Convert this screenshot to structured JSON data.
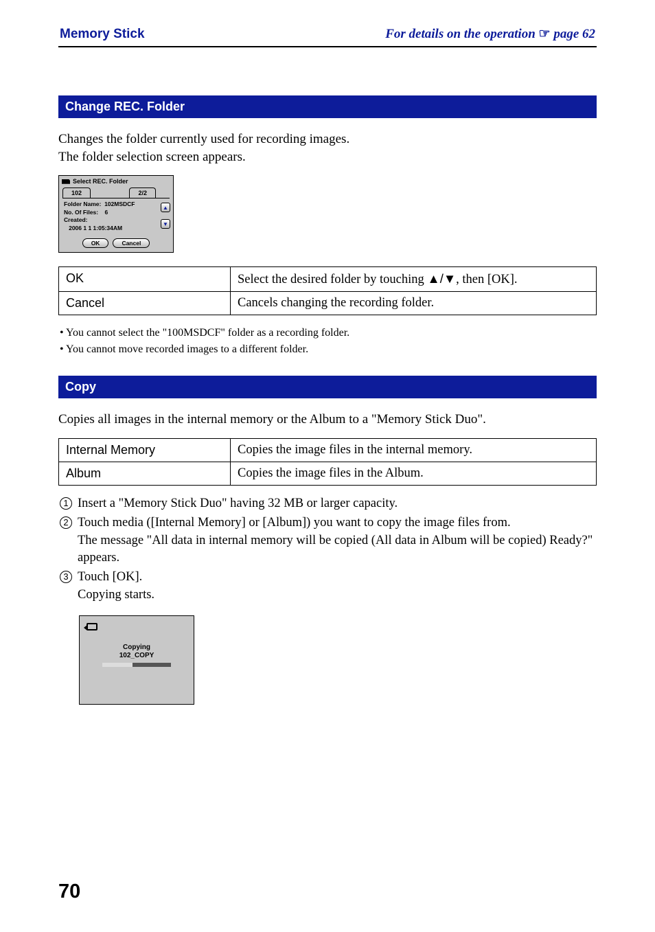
{
  "header": {
    "left": "Memory Stick",
    "right_prefix": "For details on the operation ",
    "right_hand": "☞",
    "right_suffix": " page 62"
  },
  "section1": {
    "title": "Change REC. Folder",
    "para": "Changes the folder currently used for recording images.\nThe folder selection screen appears.",
    "dialog": {
      "title": "Select REC. Folder",
      "tab_left": "102",
      "tab_right": "2/2",
      "folder_name_label": "Folder Name:",
      "folder_name_value": "102MSDCF",
      "no_files_label": "No. Of Files:",
      "no_files_value": "6",
      "created_label": "Created:",
      "created_value": "2006   1   1    1:05:34AM",
      "ok": "OK",
      "cancel": "Cancel"
    },
    "table": {
      "row1": {
        "label": "OK",
        "desc_pre": "Select the desired folder by touching ",
        "arrows": "▲/▼",
        "desc_post": ", then [OK]."
      },
      "row2": {
        "label": "Cancel",
        "desc": "Cancels changing the recording folder."
      }
    },
    "notes": [
      "You cannot select the \"100MSDCF\" folder as a recording folder.",
      "You cannot move recorded images to a different folder."
    ]
  },
  "section2": {
    "title": "Copy",
    "para": "Copies all images in the internal memory or the Album to a \"Memory Stick Duo\".",
    "table": {
      "row1": {
        "label": "Internal Memory",
        "desc": "Copies the image files in the internal memory."
      },
      "row2": {
        "label": "Album",
        "desc": "Copies the image files in the Album."
      }
    },
    "steps": {
      "s1": "Insert a \"Memory Stick Duo\" having 32 MB or larger capacity.",
      "s2": "Touch media ([Internal Memory] or [Album]) you want to copy the image files from.\nThe message \"All data in internal memory will be copied (All data in Album will be copied) Ready?\" appears.",
      "s3": "Touch [OK].\nCopying starts."
    },
    "copy_dialog": {
      "line1": "Copying",
      "line2": "102_COPY"
    }
  },
  "page_number": "70"
}
